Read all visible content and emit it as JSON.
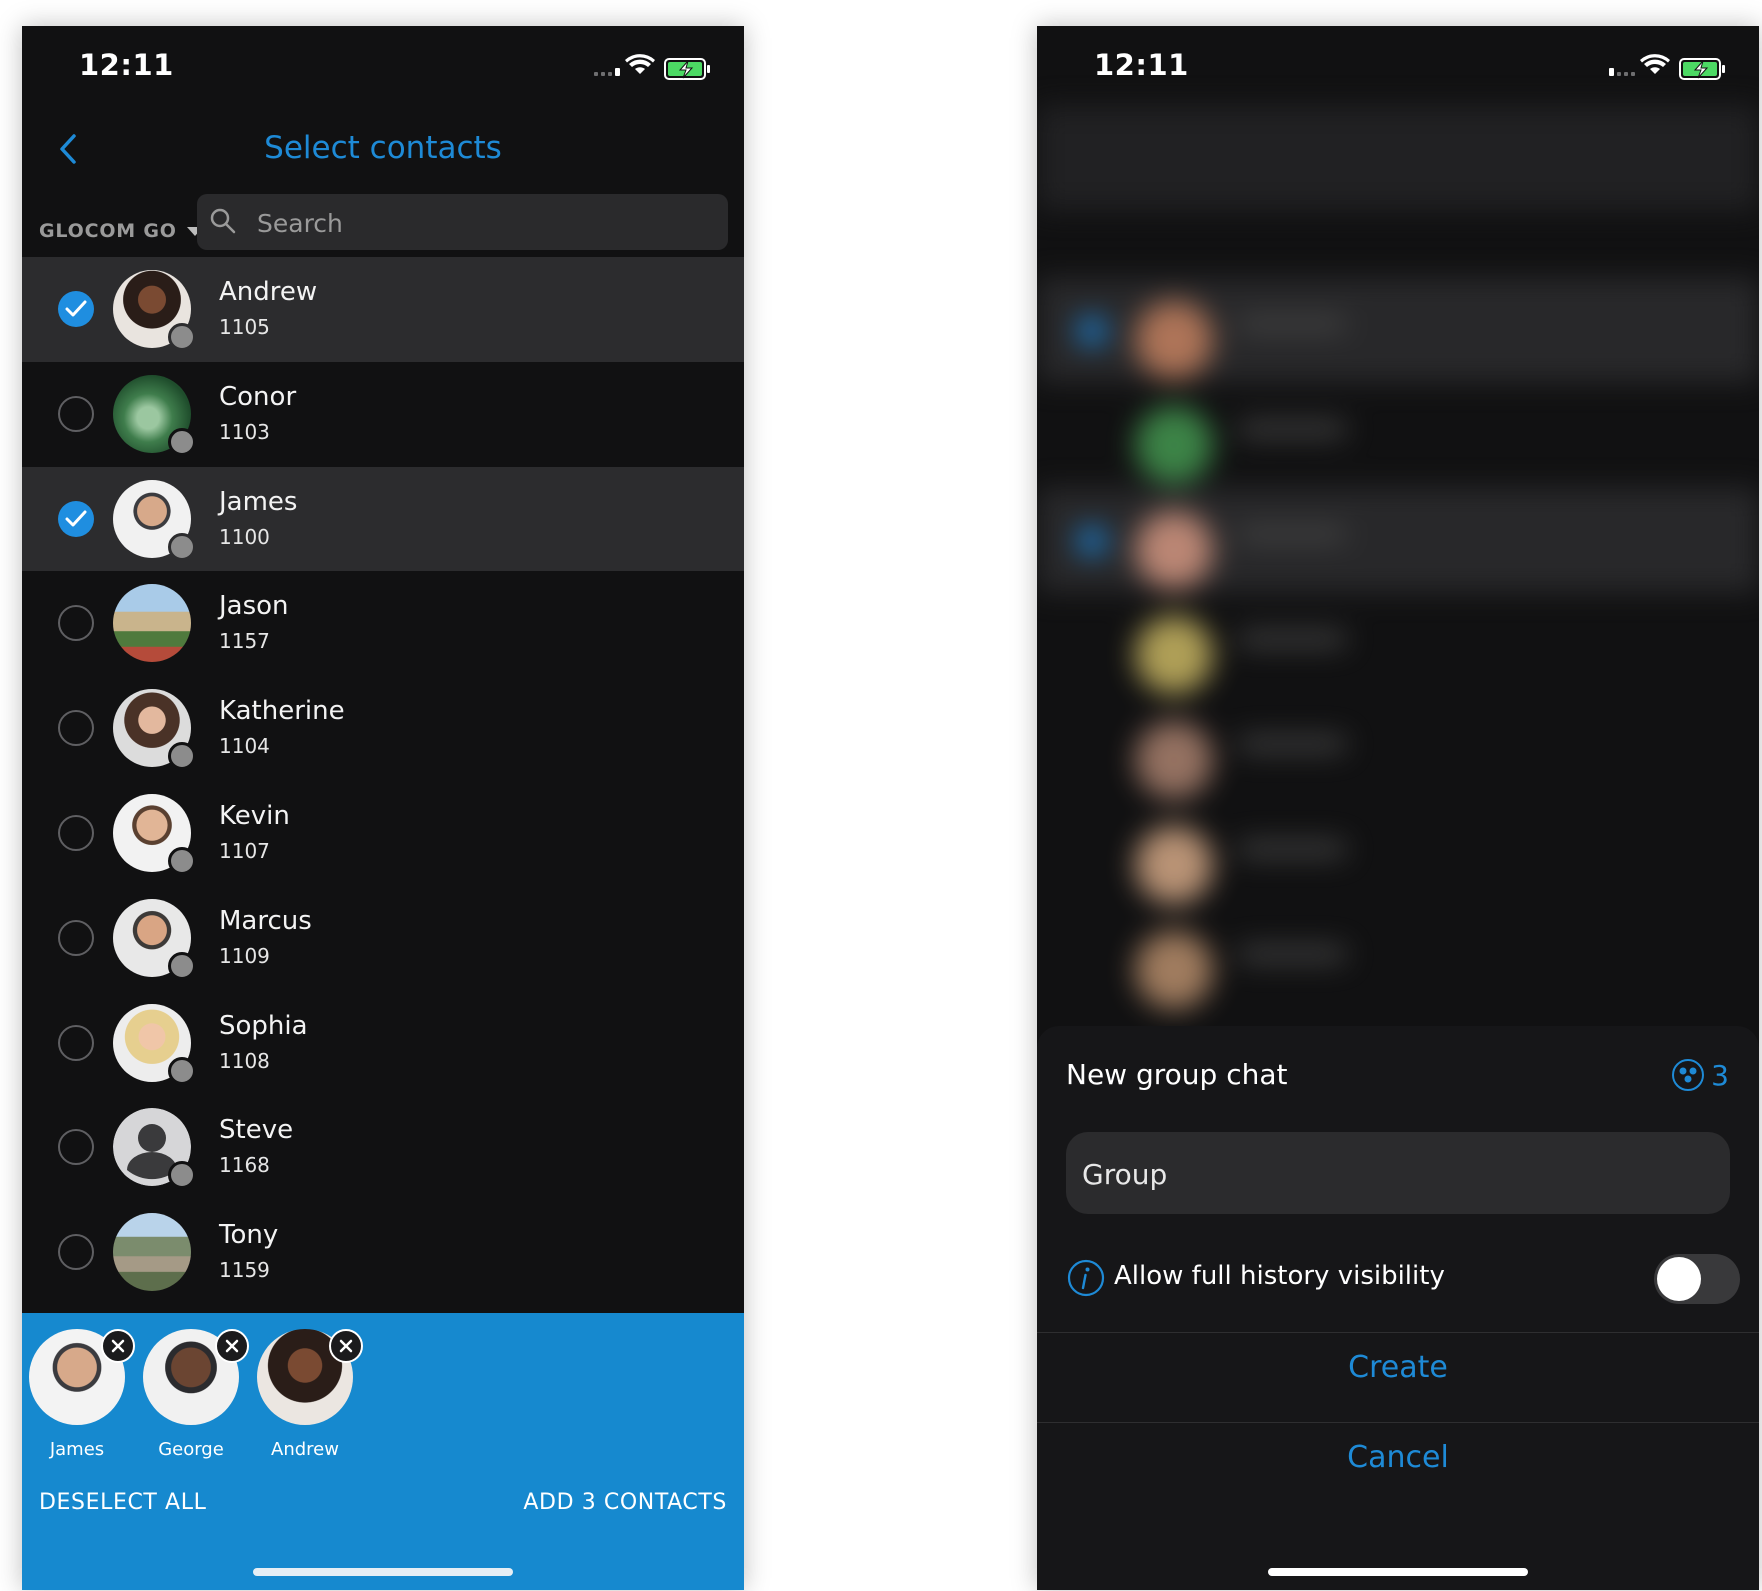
{
  "left_screen": {
    "status_bar": {
      "time": "12:11"
    },
    "header": {
      "title": "Select contacts"
    },
    "source_select": {
      "label": "GLOCOM GO"
    },
    "search": {
      "placeholder": "Search"
    },
    "contacts": [
      {
        "name": "Andrew",
        "ext": "1105",
        "selected": true
      },
      {
        "name": "Conor",
        "ext": "1103",
        "selected": false
      },
      {
        "name": "James",
        "ext": "1100",
        "selected": true
      },
      {
        "name": "Jason",
        "ext": "1157",
        "selected": false
      },
      {
        "name": "Katherine",
        "ext": "1104",
        "selected": false
      },
      {
        "name": "Kevin",
        "ext": "1107",
        "selected": false
      },
      {
        "name": "Marcus",
        "ext": "1109",
        "selected": false
      },
      {
        "name": "Sophia",
        "ext": "1108",
        "selected": false
      },
      {
        "name": "Steve",
        "ext": "1168",
        "selected": false
      },
      {
        "name": "Tony",
        "ext": "1159",
        "selected": false
      }
    ],
    "selection_bar": {
      "chips": [
        {
          "name": "James"
        },
        {
          "name": "George"
        },
        {
          "name": "Andrew"
        }
      ],
      "deselect_label": "DESELECT ALL",
      "add_label": "ADD 3 CONTACTS"
    }
  },
  "right_screen": {
    "status_bar": {
      "time": "12:11"
    },
    "sheet": {
      "title": "New group chat",
      "member_count": "3",
      "group_name_value": "Group",
      "history_label": "Allow full history visibility",
      "history_enabled": false,
      "create_label": "Create",
      "cancel_label": "Cancel"
    }
  },
  "colors": {
    "accent": "#1e8ad6",
    "background": "#111112",
    "selected_row": "#2c2c2e",
    "selection_bar": "#1689cf",
    "presence_offline": "#8c8c8c"
  }
}
